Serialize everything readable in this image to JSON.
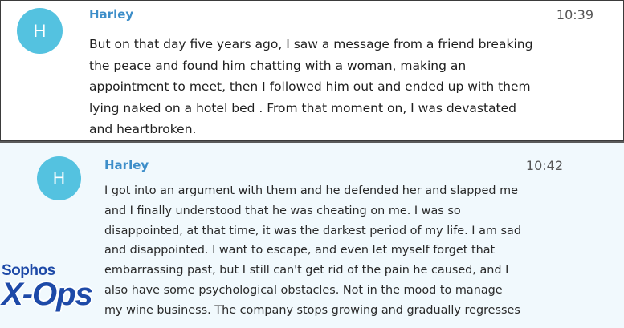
{
  "messages": [
    {
      "avatar_initial": "H",
      "author": "Harley",
      "time": "10:39",
      "text": "But on that day five years ago, I saw a message from a friend breaking\nthe peace and found him chatting with a woman, making an\nappointment to meet, then I followed him out and ended up with them\nlying naked on a hotel bed . From that moment on, I was devastated\nand heartbroken."
    },
    {
      "avatar_initial": "H",
      "author": "Harley",
      "time": "10:42",
      "text": "I got into an argument with them and he defended her and slapped me\nand I finally understood that he was cheating on me. I was so\ndisappointed, at that time, it was the darkest period of my life. I am sad\nand disappointed. I want to escape, and even let myself forget that\nembarrassing past, but I still can't get rid of the pain he caused, and I\nalso have some psychological obstacles. Not in the mood to manage\nmy wine business. The company stops growing and gradually regresses"
    }
  ],
  "watermark": {
    "brand": "Sophos",
    "product": "X-Ops"
  },
  "colors": {
    "avatar": "#54c2e0",
    "author_name": "#3d8ec9",
    "logo": "#1e4aa8",
    "second_panel_bg": "#f1f9fd"
  }
}
